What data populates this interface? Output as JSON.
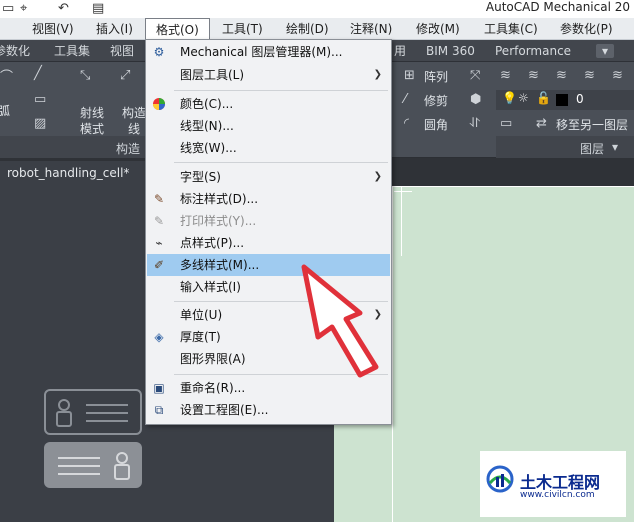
{
  "titlebar": {
    "app_title": "AutoCAD Mechanical 20"
  },
  "menubar": {
    "items": [
      "视图(V)",
      "插入(I)",
      "格式(O)",
      "工具(T)",
      "绘制(D)",
      "注释(N)",
      "修改(M)",
      "工具集(C)",
      "参数化(P)"
    ]
  },
  "ribbon": {
    "tabs": [
      "参数化",
      "工具集",
      "视图",
      "用",
      "BIM 360",
      "Performance"
    ],
    "left_buttons": [
      "弧",
      "射线",
      "模式",
      "构造",
      "线"
    ],
    "panel_titles": {
      "construct": "构造",
      "layer": "图层"
    },
    "right_buttons": [
      "阵列",
      "修剪",
      "圆角",
      "移至另一图层"
    ],
    "layer_value": "0"
  },
  "file_tab": {
    "name": "robot_handling_cell*"
  },
  "format_menu": {
    "items": [
      {
        "label": "Mechanical 图层管理器(M)...",
        "icon": "layer-manager-icon",
        "submenu": false,
        "disabled": false
      },
      {
        "label": "图层工具(L)",
        "icon": "",
        "submenu": true,
        "disabled": false
      },
      {
        "label": "颜色(C)...",
        "icon": "color-wheel-icon",
        "submenu": false,
        "disabled": false
      },
      {
        "label": "线型(N)...",
        "icon": "",
        "submenu": false,
        "disabled": false
      },
      {
        "label": "线宽(W)...",
        "icon": "",
        "submenu": false,
        "disabled": false
      },
      {
        "label": "字型(S)",
        "icon": "",
        "submenu": true,
        "disabled": false
      },
      {
        "label": "标注样式(D)...",
        "icon": "dim-style-icon",
        "submenu": false,
        "disabled": false
      },
      {
        "label": "打印样式(Y)...",
        "icon": "plot-style-icon",
        "submenu": false,
        "disabled": true
      },
      {
        "label": "点样式(P)...",
        "icon": "point-style-icon",
        "submenu": false,
        "disabled": false
      },
      {
        "label": "多线样式(M)...",
        "icon": "mline-style-icon",
        "submenu": false,
        "disabled": false,
        "highlighted": true
      },
      {
        "label": "输入样式(I)",
        "icon": "",
        "submenu": false,
        "disabled": false
      },
      {
        "label": "单位(U)",
        "icon": "",
        "submenu": true,
        "disabled": false
      },
      {
        "label": "厚度(T)",
        "icon": "thickness-icon",
        "submenu": false,
        "disabled": false
      },
      {
        "label": "图形界限(A)",
        "icon": "",
        "submenu": false,
        "disabled": false
      },
      {
        "label": "重命名(R)...",
        "icon": "rename-icon",
        "submenu": false,
        "disabled": false
      },
      {
        "label": "设置工程图(E)...",
        "icon": "drawing-setup-icon",
        "submenu": false,
        "disabled": false
      }
    ]
  },
  "watermark": {
    "name": "土木工程网",
    "url": "www.civilcn.com"
  },
  "colors": {
    "highlight": "#9fcbf0",
    "drawing_bg": "#cde3d0",
    "arrow": "#e0313a"
  }
}
